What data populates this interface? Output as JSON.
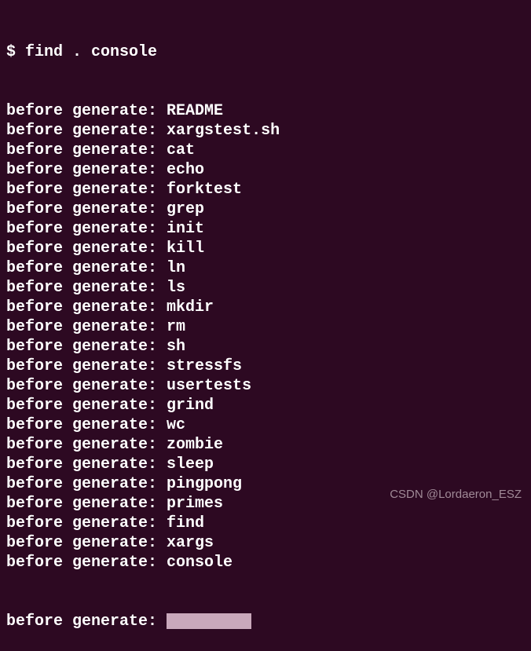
{
  "terminal": {
    "prompt": "$ ",
    "command": "find . console",
    "prefix": "before generate: ",
    "entries": [
      "README",
      "xargstest.sh",
      "cat",
      "echo",
      "forktest",
      "grep",
      "init",
      "kill",
      "ln",
      "ls",
      "mkdir",
      "rm",
      "sh",
      "stressfs",
      "usertests",
      "grind",
      "wc",
      "zombie",
      "sleep",
      "pingpong",
      "primes",
      "find",
      "xargs",
      "console"
    ]
  },
  "watermark": "CSDN @Lordaeron_ESZ"
}
